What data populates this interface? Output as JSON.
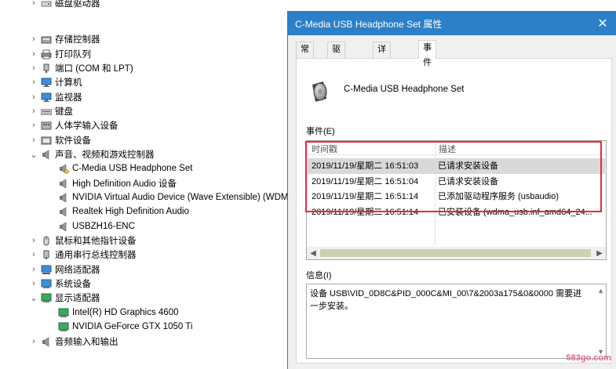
{
  "tree": {
    "items": [
      {
        "label": "磁盘驱动器",
        "expanded": false,
        "level": 0,
        "icon": "disk-drive-icon"
      },
      {
        "label": "存储控制器",
        "expanded": false,
        "level": 0,
        "icon": "storage-controller-icon"
      },
      {
        "label": "打印队列",
        "expanded": false,
        "level": 0,
        "icon": "printer-icon"
      },
      {
        "label": "端口 (COM 和 LPT)",
        "expanded": false,
        "level": 0,
        "icon": "port-icon"
      },
      {
        "label": "计算机",
        "expanded": false,
        "level": 0,
        "icon": "computer-icon"
      },
      {
        "label": "监视器",
        "expanded": false,
        "level": 0,
        "icon": "monitor-icon"
      },
      {
        "label": "键盘",
        "expanded": false,
        "level": 0,
        "icon": "keyboard-icon"
      },
      {
        "label": "人体学输入设备",
        "expanded": false,
        "level": 0,
        "icon": "hid-icon"
      },
      {
        "label": "软件设备",
        "expanded": false,
        "level": 0,
        "icon": "software-device-icon"
      },
      {
        "label": "声音、视频和游戏控制器",
        "expanded": true,
        "level": 0,
        "icon": "speaker-icon"
      },
      {
        "label": "C-Media USB Headphone Set",
        "level": 1,
        "icon": "audio-warning-icon"
      },
      {
        "label": "High Definition Audio 设备",
        "level": 1,
        "icon": "speaker-icon"
      },
      {
        "label": "NVIDIA Virtual Audio Device (Wave Extensible) (WDM)",
        "level": 1,
        "icon": "speaker-icon"
      },
      {
        "label": "Realtek High Definition Audio",
        "level": 1,
        "icon": "speaker-icon"
      },
      {
        "label": "USBZH16-ENC",
        "level": 1,
        "icon": "speaker-icon"
      },
      {
        "label": "鼠标和其他指针设备",
        "expanded": false,
        "level": 0,
        "icon": "mouse-icon"
      },
      {
        "label": "通用串行总线控制器",
        "expanded": false,
        "level": 0,
        "icon": "usb-icon"
      },
      {
        "label": "网络适配器",
        "expanded": false,
        "level": 0,
        "icon": "network-icon"
      },
      {
        "label": "系统设备",
        "expanded": false,
        "level": 0,
        "icon": "system-device-icon"
      },
      {
        "label": "显示适配器",
        "expanded": true,
        "level": 0,
        "icon": "display-adapter-icon"
      },
      {
        "label": "Intel(R) HD Graphics 4600",
        "level": 1,
        "icon": "display-adapter-icon"
      },
      {
        "label": "NVIDIA GeForce GTX 1050 Ti",
        "level": 1,
        "icon": "display-adapter-icon"
      },
      {
        "label": "音频输入和输出",
        "expanded": false,
        "level": 0,
        "icon": "audio-io-icon"
      }
    ]
  },
  "dialog": {
    "title": "C-Media USB Headphone Set   属性",
    "close_glyph": "✕",
    "tabs": [
      "常规",
      "驱动程序",
      "详细信息",
      "事件"
    ],
    "active_tab": 3,
    "device_name": "C-Media USB Headphone Set",
    "events_label": "事件(E)",
    "columns": [
      "时间戳",
      "描述"
    ],
    "events": [
      {
        "time": "2019/11/19/星期二 16:51:03",
        "desc": "已请求安装设备"
      },
      {
        "time": "2019/11/19/星期二 16:51:04",
        "desc": "已请求安装设备"
      },
      {
        "time": "2019/11/19/星期二 16:51:14",
        "desc": "已添加驱动程序服务 (usbaudio)"
      },
      {
        "time": "2019/11/19/星期二 16:51:14",
        "desc": "已安装设备 (wdma_usb.inf_amd64_24..."
      }
    ],
    "selected_event": 0,
    "info_label": "信息(I)",
    "info_text": "设备 USB\\VID_0D8C&PID_000C&MI_00\\7&2003a175&0&0000 需要进一步安装。"
  },
  "watermark": "583go.com",
  "colors": {
    "titlebar": "#2b80c8",
    "highlight_box": "#e8283a",
    "selected_row": "#d9d9d9"
  }
}
